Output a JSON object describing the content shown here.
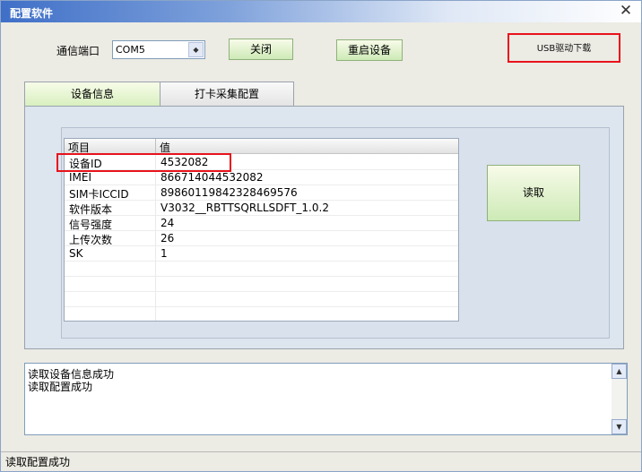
{
  "window": {
    "title": "配置软件"
  },
  "toolbar": {
    "port_label": "通信端口",
    "port_value": "COM5",
    "close_label": "关闭",
    "restart_label": "重启设备",
    "usb_link": "USB驱动下载"
  },
  "tabs": [
    {
      "label": "设备信息",
      "active": true
    },
    {
      "label": "打卡采集配置",
      "active": false
    }
  ],
  "device_list": {
    "columns": [
      "项目",
      "值"
    ],
    "rows": [
      {
        "key": "设备ID",
        "value": "4532082"
      },
      {
        "key": "IMEI",
        "value": "866714044532082"
      },
      {
        "key": "SIM卡ICCID",
        "value": "89860119842328469576"
      },
      {
        "key": "软件版本",
        "value": "V3032__RBTTSQRLLSDFT_1.0.2"
      },
      {
        "key": "信号强度",
        "value": "24"
      },
      {
        "key": "上传次数",
        "value": "26"
      },
      {
        "key": "SK",
        "value": "1"
      }
    ]
  },
  "read_button": {
    "label": "读取"
  },
  "log": {
    "lines": [
      "读取设备信息成功",
      "读取配置成功"
    ]
  },
  "status": {
    "text": "读取配置成功"
  },
  "colors": {
    "highlight": "#e8121b",
    "button_green": "#cdeab6",
    "title_blue": "#3f6fc7"
  },
  "icons": {
    "close": "close-icon",
    "dropdown": "chevron-down-icon",
    "scroll_up": "scroll-up-icon",
    "scroll_down": "scroll-down-icon"
  }
}
